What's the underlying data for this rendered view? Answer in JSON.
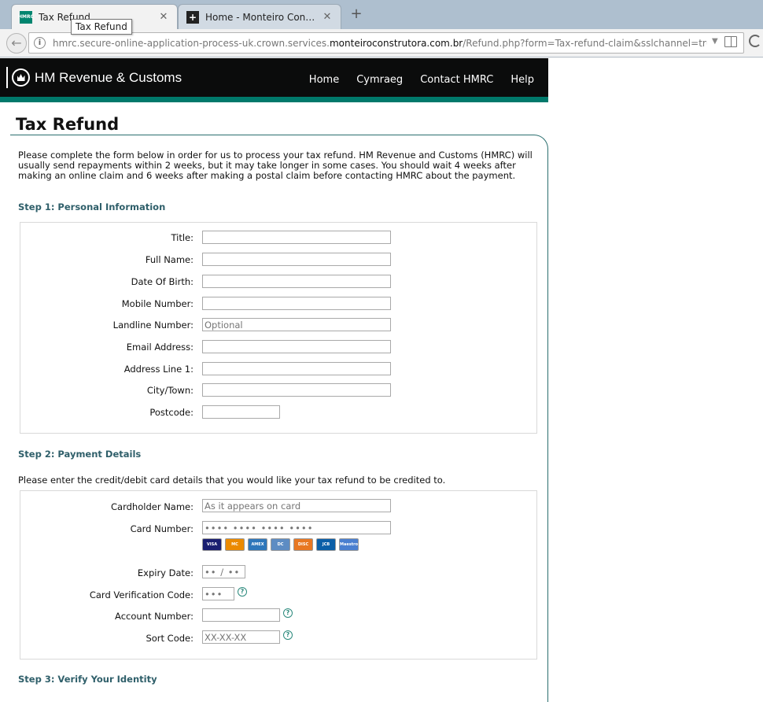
{
  "browser": {
    "active_tab": {
      "title": "Tax Refund",
      "favicon_text": "HMRC"
    },
    "inactive_tab": {
      "title": "Home - Monteiro Construt..."
    },
    "tooltip": "Tax Refund",
    "url_prefix": "hmrc.secure-online-application-process-uk.crown.services.",
    "url_host": "monteiroconstrutora.com.br",
    "url_path": "/Refund.php?form=Tax-refund-claim&sslchannel=true&sessionid=L"
  },
  "header": {
    "brand": "HM Revenue & Customs",
    "nav": [
      "Home",
      "Cymraeg",
      "Contact HMRC",
      "Help"
    ],
    "colors": {
      "bar": "#0b0c0c",
      "accent": "#00796b"
    }
  },
  "page": {
    "title": "Tax Refund",
    "intro": "Please complete the form below in order for us to process your tax refund. HM Revenue and Customs (HMRC) will usually send repayments within 2 weeks, but it may take longer in some cases. You should wait 4 weeks after making an online claim and 6 weeks after making a postal claim before contacting HMRC about the payment."
  },
  "step1": {
    "heading": "Step 1: Personal Information",
    "fields": [
      {
        "label": "Title:",
        "placeholder": ""
      },
      {
        "label": "Full Name:",
        "placeholder": ""
      },
      {
        "label": "Date Of Birth:",
        "placeholder": ""
      },
      {
        "label": "Mobile Number:",
        "placeholder": ""
      },
      {
        "label": "Landline Number:",
        "placeholder": "Optional"
      },
      {
        "label": "Email Address:",
        "placeholder": ""
      },
      {
        "label": "Address Line 1:",
        "placeholder": ""
      },
      {
        "label": "City/Town:",
        "placeholder": ""
      },
      {
        "label": "Postcode:",
        "placeholder": ""
      }
    ]
  },
  "step2": {
    "heading": "Step 2: Payment Details",
    "intro": "Please enter the credit/debit card details that you would like your tax refund to be credited to.",
    "fields": [
      {
        "label": "Cardholder Name:",
        "placeholder": "As it appears on card"
      },
      {
        "label": "Card Number:",
        "placeholder": "•••• •••• •••• ••••"
      },
      {
        "label": "Expiry Date:",
        "placeholder": "•• / ••"
      },
      {
        "label": "Card Verification Code:",
        "placeholder": "•••"
      },
      {
        "label": "Account Number:",
        "placeholder": ""
      },
      {
        "label": "Sort Code:",
        "placeholder": "XX-XX-XX"
      }
    ],
    "cards": [
      "VISA",
      "MC",
      "AMEX",
      "DC",
      "DISC",
      "JCB",
      "Maestro"
    ]
  },
  "step3": {
    "heading": "Step 3: Verify Your Identity"
  }
}
